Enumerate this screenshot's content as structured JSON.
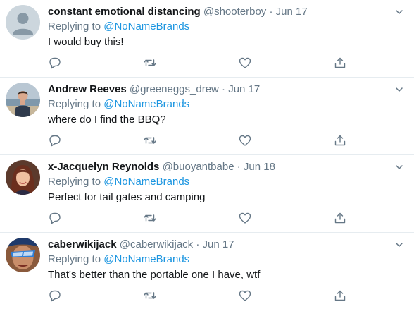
{
  "tweets": [
    {
      "name": "constant emotional distancing",
      "handle": "@shooterboy",
      "date": "Jun 17",
      "replying_prefix": "Replying to",
      "replying_to": "@NoNameBrands",
      "text": "I would buy this!",
      "avatar_icon": "default-profile-icon"
    },
    {
      "name": "Andrew Reeves",
      "handle": "@greeneggs_drew",
      "date": "Jun 17",
      "replying_prefix": "Replying to",
      "replying_to": "@NoNameBrands",
      "text": "where do I find the BBQ?",
      "avatar_icon": "beach-photo-avatar"
    },
    {
      "name": "x-Jacquelyn Reynolds",
      "handle": "@buoyantbabe",
      "date": "Jun 18",
      "replying_prefix": "Replying to",
      "replying_to": "@NoNameBrands",
      "text": "Perfect for tail gates and camping",
      "avatar_icon": "portrait-photo-avatar"
    },
    {
      "name": "caberwikijack",
      "handle": "@caberwikijack",
      "date": "Jun 17",
      "replying_prefix": "Replying to",
      "replying_to": "@NoNameBrands",
      "text": "That's better than the portable one I have, wtf",
      "avatar_icon": "sunglasses-photo-avatar"
    }
  ],
  "colors": {
    "link": "#1b95e0",
    "muted": "#657786",
    "text": "#14171a",
    "divider": "#e6ecf0"
  },
  "icons": {
    "reply": "reply-icon",
    "retweet": "retweet-icon",
    "like": "heart-icon",
    "share": "share-icon",
    "more": "chevron-down-icon"
  }
}
